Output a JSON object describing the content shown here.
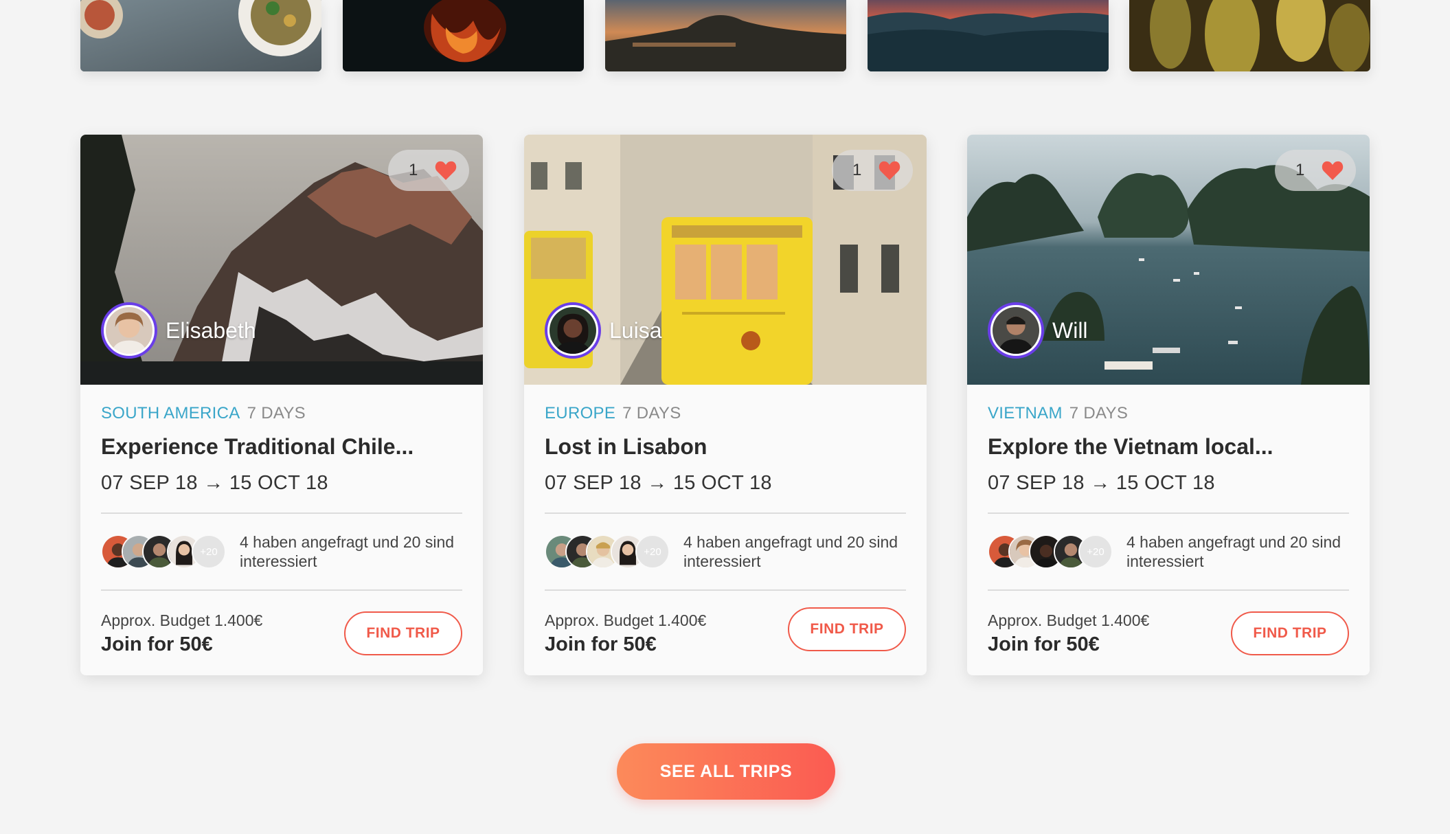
{
  "top_strip": [
    {
      "name": "food-photo"
    },
    {
      "name": "fire-photo"
    },
    {
      "name": "sunset-volcano-photo"
    },
    {
      "name": "mountain-dusk-photo"
    },
    {
      "name": "cactus-photo"
    }
  ],
  "trips": [
    {
      "likes": "1",
      "host": "Elisabeth",
      "region": "SOUTH AMERICA",
      "days": "7 DAYS",
      "title": "Experience Traditional Chile...",
      "dates": "07 SEP 18 → 15 OCT 18",
      "extra_count": "+20",
      "requests_text": "4 haben angefragt und 20 sind interessiert",
      "budget": "Approx. Budget 1.400€",
      "join": "Join for 50€",
      "cta": "FIND TRIP"
    },
    {
      "likes": "1",
      "host": "Luisa",
      "region": "EUROPE",
      "days": "7 DAYS",
      "title": "Lost in Lisabon",
      "dates": "07 SEP 18 → 15 OCT 18",
      "extra_count": "+20",
      "requests_text": "4 haben angefragt und 20 sind interessiert",
      "budget": "Approx. Budget 1.400€",
      "join": "Join for 50€",
      "cta": "FIND TRIP"
    },
    {
      "likes": "1",
      "host": "Will",
      "region": "VIETNAM",
      "days": "7 DAYS",
      "title": "Explore the Vietnam local...",
      "dates": "07 SEP 18 → 15 OCT 18",
      "extra_count": "+20",
      "requests_text": "4 haben angefragt und 20 sind interessiert",
      "budget": "Approx. Budget 1.400€",
      "join": "Join for 50€",
      "cta": "FIND TRIP"
    }
  ],
  "see_all_label": "SEE ALL TRIPS",
  "colors": {
    "accent": "#f05a4a",
    "region": "#3aa6c9",
    "avatar_ring": "#6a3ee8",
    "gradient_start": "#fc8a5a",
    "gradient_end": "#fb5b52"
  }
}
